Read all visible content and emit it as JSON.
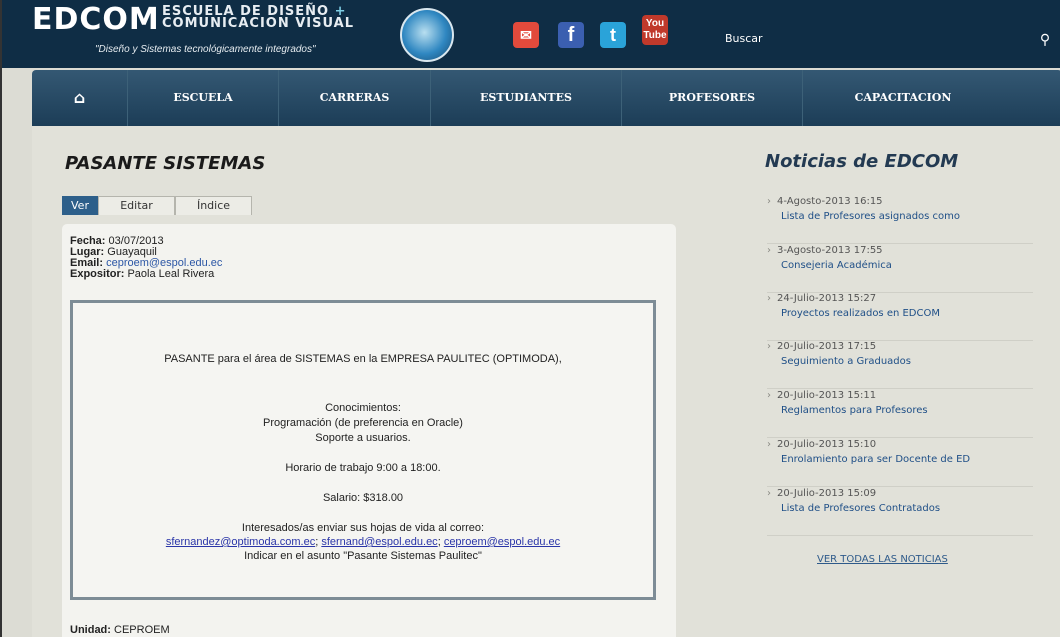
{
  "header": {
    "logo": "EDCOM",
    "logo_line1": "ESCUELA DE DISEÑO",
    "logo_line2": "COMUNICACION VISUAL",
    "tagline": "\"Diseño y Sistemas tecnológicamente integrados\"",
    "social": {
      "mail": "✉",
      "facebook": "f",
      "twitter": "t",
      "youtube": "You Tube"
    },
    "search_label": "Buscar",
    "search_icon": "⚲"
  },
  "nav": {
    "home_icon": "⌂",
    "items": [
      {
        "label": "ESCUELA"
      },
      {
        "label": "CARRERAS"
      },
      {
        "label": "ESTUDIANTES"
      },
      {
        "label": "PROFESORES"
      },
      {
        "label": "CAPACITACION"
      }
    ]
  },
  "page": {
    "title": "PASANTE SISTEMAS",
    "tabs": [
      {
        "label": "Ver",
        "active": true
      },
      {
        "label": "Editar"
      },
      {
        "label": "Índice"
      }
    ],
    "meta": {
      "fecha_label": "Fecha:",
      "fecha": "03/07/2013",
      "lugar_label": "Lugar:",
      "lugar": "Guayaquil",
      "email_label": "Email:",
      "email": "ceproem@espol.edu.ec",
      "expositor_label": "Expositor:",
      "expositor": "Paola Leal Rivera"
    },
    "notice": {
      "line1": "PASANTE para el área de SISTEMAS en la EMPRESA PAULITEC (OPTIMODA),",
      "line2": "Conocimientos:",
      "line3": "Programación (de preferencia en Oracle)",
      "line4": "Soporte a usuarios.",
      "line5": "Horario de trabajo 9:00 a 18:00.",
      "line6": "Salario: $318.00",
      "line7": "Interesados/as enviar sus hojas de vida al correo:",
      "email1": "sfernandez@optimoda.com.ec",
      "email2": "sfernand@espol.edu.ec",
      "email3": "ceproem@espol.edu.ec",
      "line9": "Indicar en el asunto \"Pasante Sistemas Paulitec\""
    },
    "unidad_label": "Unidad:",
    "unidad": "CEPROEM"
  },
  "news": {
    "title": "Noticias de EDCOM",
    "items": [
      {
        "date": "4-Agosto-2013 16:15",
        "link": "Lista de Profesores asignados como"
      },
      {
        "date": "3-Agosto-2013 17:55",
        "link": "Consejeria Académica"
      },
      {
        "date": "24-Julio-2013 15:27",
        "link": "Proyectos realizados en EDCOM"
      },
      {
        "date": "20-Julio-2013 17:15",
        "link": "Seguimiento a Graduados"
      },
      {
        "date": "20-Julio-2013 15:11",
        "link": "Reglamentos para Profesores"
      },
      {
        "date": "20-Julio-2013 15:10",
        "link": "Enrolamiento para ser Docente de ED"
      },
      {
        "date": "20-Julio-2013 15:09",
        "link": "Lista de Profesores Contratados"
      }
    ],
    "all_label": "VER TODAS LAS NOTICIAS"
  }
}
